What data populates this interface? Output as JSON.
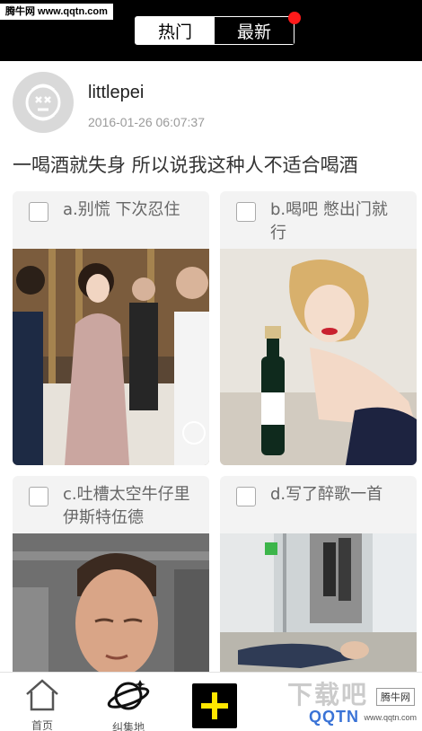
{
  "watermark_top": "腾牛网 www.qqtn.com",
  "tabs": [
    {
      "label": "热门",
      "selected": true
    },
    {
      "label": "最新",
      "selected": false,
      "badge_color": "#ff1a1a"
    }
  ],
  "post": {
    "avatar_icon": "avatar-icon",
    "username": "littlepei",
    "timestamp": "2016-01-26 06:07:37",
    "question": "一喝酒就失身 所以说我这种人不适合喝酒",
    "options": [
      {
        "label": "a.别慌 下次忍住",
        "checked": false,
        "image_icon": "photo-party"
      },
      {
        "label": "b.喝吧 憋出门就行",
        "checked": false,
        "image_icon": "photo-champagne"
      },
      {
        "label": "c.吐槽太空牛仔里伊斯特伍德",
        "checked": false,
        "image_icon": "photo-sleeping-man"
      },
      {
        "label": "d.写了醉歌一首",
        "checked": false,
        "image_icon": "photo-subway"
      }
    ]
  },
  "nav": {
    "home_label": "首页",
    "gallery_label": "纠集地",
    "add_icon": "plus-icon"
  },
  "watermark_bottom": {
    "big_text": "下载吧",
    "tag": "腾牛网",
    "logo": "QQTN",
    "url": "www.qqtn.com"
  },
  "colors": {
    "topbar": "#000000",
    "add_button_bg": "#000000",
    "add_button_icon": "#ffe600",
    "badge": "#ff1a1a"
  }
}
